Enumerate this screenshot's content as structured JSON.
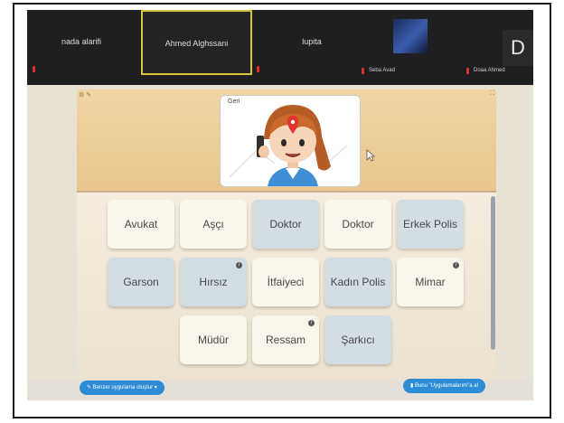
{
  "video_bar": {
    "participants": [
      {
        "name": "nada alarifi"
      },
      {
        "name": "Ahmed Alghssani"
      },
      {
        "name": "lupita"
      }
    ],
    "sub_labels": [
      "Seba Avad",
      "Doaa Ahmed"
    ],
    "avatar_initial": "D"
  },
  "scene": {
    "title": "Geri"
  },
  "jobs": {
    "row1": [
      "Avukat",
      "Aşçı",
      "Doktor",
      "Doktor",
      "Erkek Polis"
    ],
    "row2": [
      "Garson",
      "Hırsız",
      "İtfaiyeci",
      "Kadın Polis",
      "Mimar"
    ],
    "row3": [
      "Müdür",
      "Ressam",
      "Şarkıcı"
    ]
  },
  "buttons": {
    "create_similar": "Benzer uygulama oluştur",
    "save_to_apps": "Bunu \"Uygulamalarım\"a al"
  },
  "colors": {
    "accent": "#2d8cd6",
    "active_speaker": "#d9c23b",
    "mic_muted": "#e23030"
  }
}
